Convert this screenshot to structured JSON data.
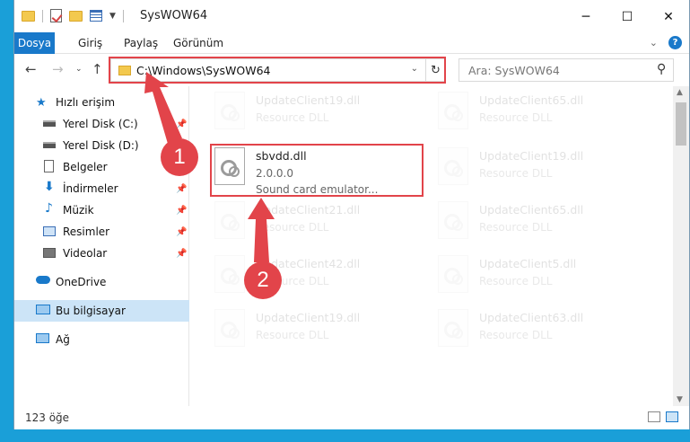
{
  "window": {
    "title": "SysWOW64",
    "controls": {
      "minimize": "─",
      "maximize": "☐",
      "close": "✕"
    }
  },
  "ribbon": {
    "tabs": [
      "Dosya",
      "Giriş",
      "Paylaş",
      "Görünüm"
    ],
    "help": "?"
  },
  "address": {
    "path": "C:\\Windows\\SysWOW64",
    "search_placeholder": "Ara: SysWOW64"
  },
  "sidebar": {
    "items": [
      {
        "label": "Hızlı erişim",
        "icon": "star-icon"
      },
      {
        "label": "Yerel Disk (C:)",
        "icon": "drive-icon"
      },
      {
        "label": "Yerel Disk (D:)",
        "icon": "drive-icon"
      },
      {
        "label": "Belgeler",
        "icon": "documents-icon"
      },
      {
        "label": "İndirmeler",
        "icon": "download-icon"
      },
      {
        "label": "Müzik",
        "icon": "music-icon"
      },
      {
        "label": "Resimler",
        "icon": "pictures-icon"
      },
      {
        "label": "Videolar",
        "icon": "videos-icon"
      },
      {
        "label": "OneDrive",
        "icon": "cloud-icon"
      },
      {
        "label": "Bu bilgisayar",
        "icon": "computer-icon"
      },
      {
        "label": "Ağ",
        "icon": "network-icon"
      }
    ]
  },
  "files": {
    "left": [
      {
        "name": "UpdateClient19.dll",
        "desc": "Resource DLL"
      },
      {
        "name": "sbvdd.dll",
        "version": "2.0.0.0",
        "desc": "Sound card emulator..."
      },
      {
        "name": "UpdateClient21.dll",
        "desc": "Resource DLL"
      },
      {
        "name": "UpdateClient42.dll",
        "desc": "Resource DLL"
      },
      {
        "name": "UpdateClient19.dll",
        "desc": "Resource DLL"
      }
    ],
    "right": [
      {
        "name": "UpdateClient65.dll",
        "desc": "Resource DLL"
      },
      {
        "name": "UpdateClient19.dll",
        "desc": "Resource DLL"
      },
      {
        "name": "UpdateClient65.dll",
        "desc": "Resource DLL"
      },
      {
        "name": "UpdateClient5.dll",
        "desc": "Resource DLL"
      },
      {
        "name": "UpdateClient63.dll",
        "desc": "Resource DLL"
      }
    ]
  },
  "status": {
    "count": "123 öğe"
  },
  "annotations": {
    "step1": "1",
    "step2": "2",
    "color": "#e2444a"
  }
}
